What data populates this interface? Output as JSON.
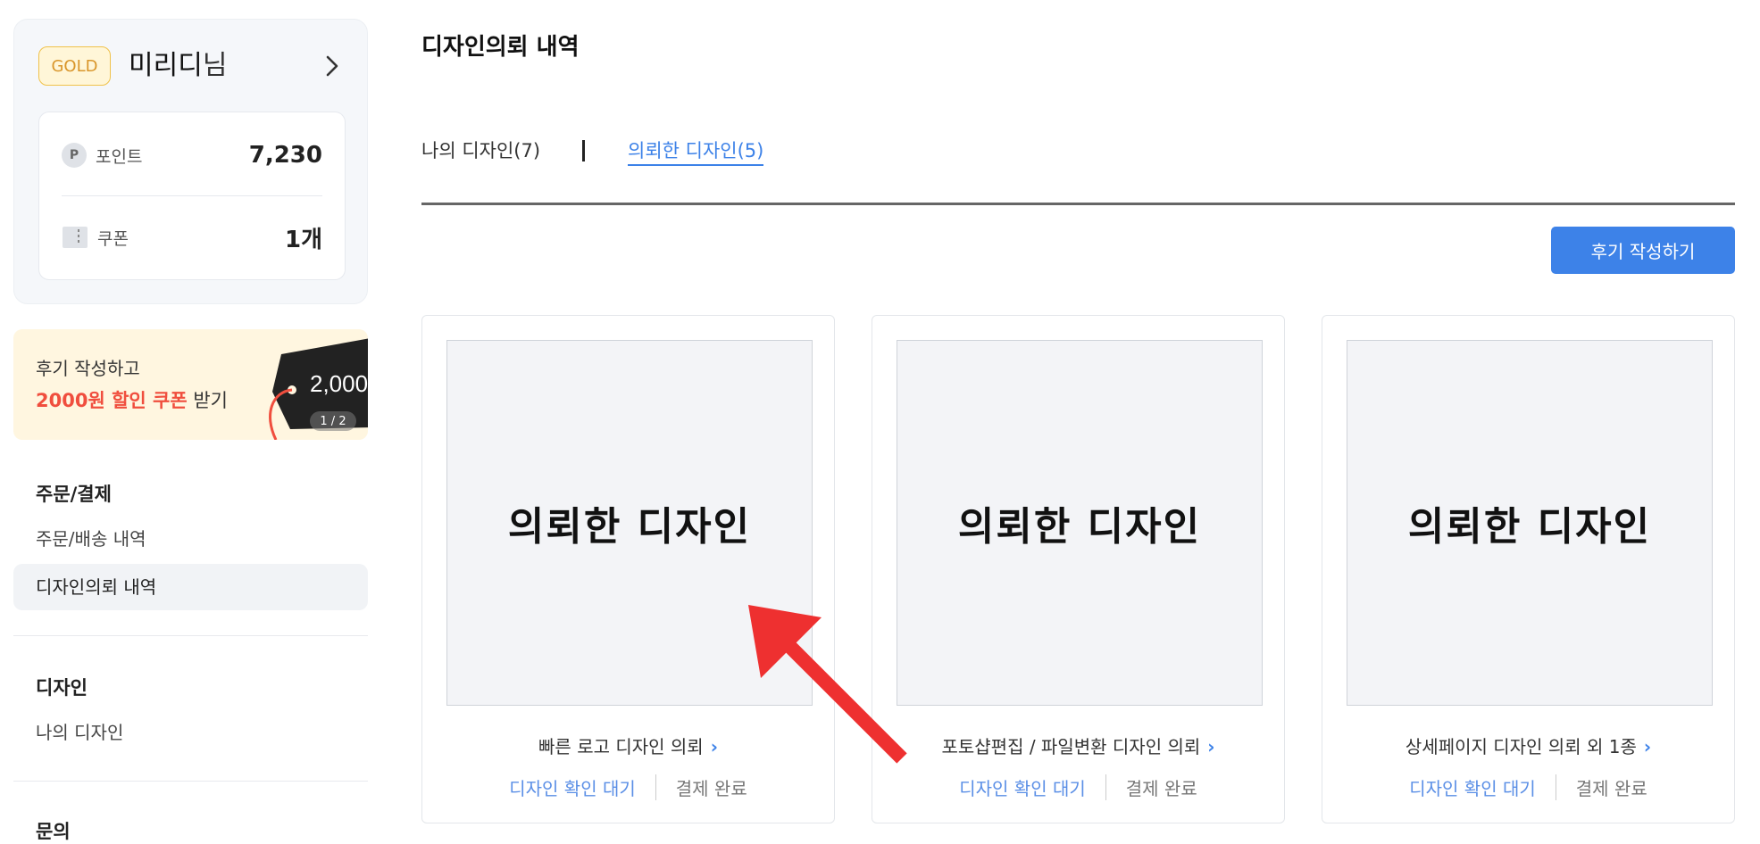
{
  "profile": {
    "grade": "GOLD",
    "name": "미리디",
    "honorific": "님",
    "points_label": "포인트",
    "points_value": "7,230",
    "coupons_label": "쿠폰",
    "coupons_value": "1개"
  },
  "promo": {
    "line1": "후기 작성하고",
    "highlight": "2000원 할인 쿠폰",
    "suffix": " 받기",
    "tag_amount": "2,000",
    "page": "1 / 2"
  },
  "sidebar": {
    "sections": [
      {
        "heading": "주문/결제",
        "items": [
          "주문/배송 내역",
          "디자인의뢰 내역"
        ]
      },
      {
        "heading": "디자인",
        "items": [
          "나의 디자인"
        ]
      },
      {
        "heading": "문의",
        "items": []
      }
    ]
  },
  "main": {
    "title": "디자인의뢰 내역",
    "tabs": [
      {
        "label": "나의 디자인(7)",
        "active": false
      },
      {
        "label": "의뢰한 디자인(5)",
        "active": true
      }
    ],
    "review_button": "후기 작성하기",
    "cards": [
      {
        "thumb_text": "의뢰한 디자인",
        "title": "빠른 로고 디자인 의뢰",
        "status": "디자인 확인 대기",
        "payment": "결제 완료"
      },
      {
        "thumb_text": "의뢰한 디자인",
        "title": "포토샵편집 / 파일변환 디자인 의뢰",
        "status": "디자인 확인 대기",
        "payment": "결제 완료"
      },
      {
        "thumb_text": "의뢰한 디자인",
        "title": "상세페이지 디자인 의뢰 외 1종",
        "status": "디자인 확인 대기",
        "payment": "결제 완료"
      }
    ]
  },
  "colors": {
    "accent": "#3d82e8",
    "promo_highlight": "#f04e3e",
    "gold": "#d9962b",
    "annotation_arrow": "#ee3030"
  }
}
